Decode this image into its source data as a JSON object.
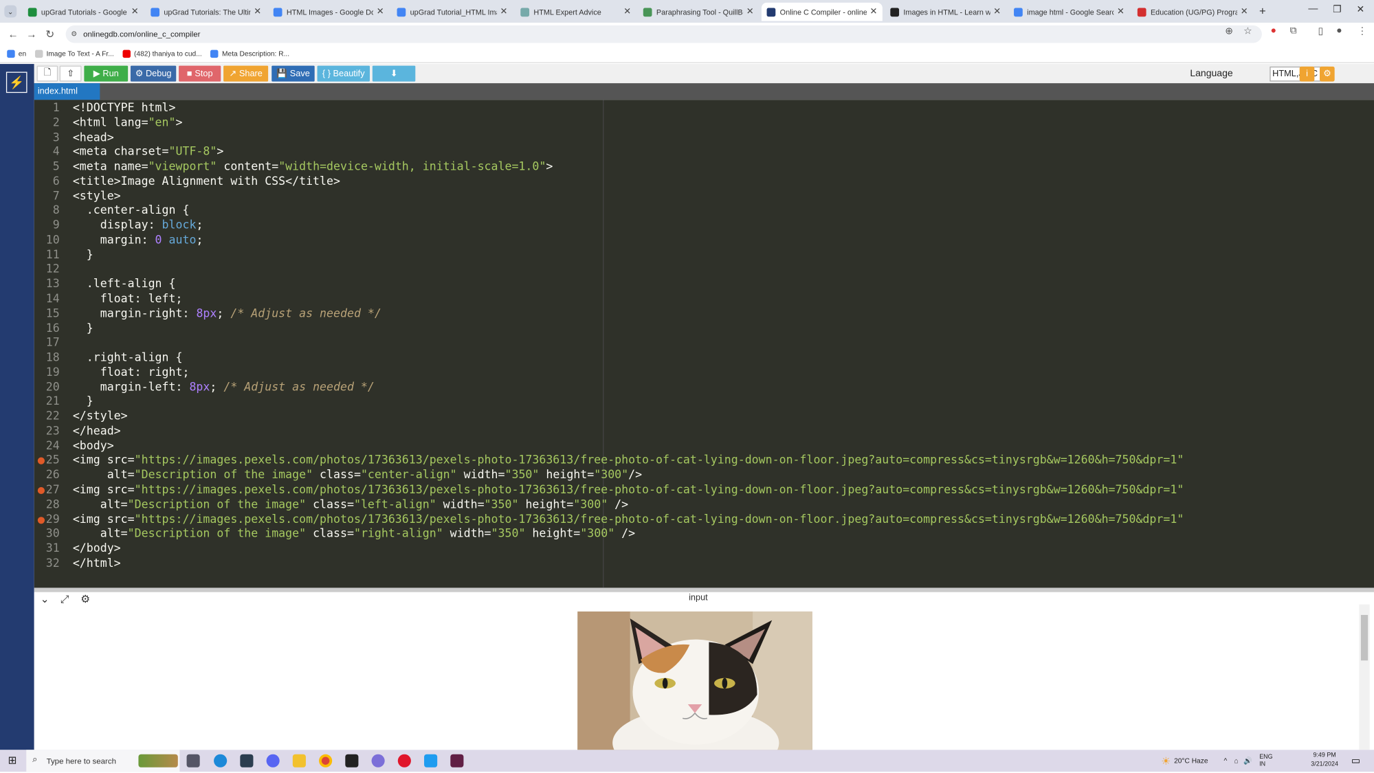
{
  "browser": {
    "tabs": [
      {
        "title": "upGrad Tutorials - Google Sh",
        "color": "#1e8e3e"
      },
      {
        "title": "upGrad Tutorials: The Ultimat",
        "color": "#4285f4"
      },
      {
        "title": "HTML Images - Google Docs",
        "color": "#4285f4"
      },
      {
        "title": "upGrad Tutorial_HTML Image",
        "color": "#4285f4"
      },
      {
        "title": "HTML Expert Advice",
        "color": "#7aa"
      },
      {
        "title": "Paraphrasing Tool - QuillBot A",
        "color": "#499557"
      },
      {
        "title": "Online C Compiler - online ed",
        "color": "#233b70"
      },
      {
        "title": "Images in HTML - Learn web",
        "color": "#222"
      },
      {
        "title": "image html - Google Search",
        "color": "#4285f4"
      },
      {
        "title": "Education (UG/PG) Programs",
        "color": "#d32f2f"
      }
    ],
    "url": "onlinegdb.com/online_c_compiler",
    "bookmarks": [
      {
        "label": "en",
        "color": "#4285f4"
      },
      {
        "label": "Image To Text - A Fr...",
        "color": "#ccc"
      },
      {
        "label": "(482) thaniya to cud...",
        "color": "#e00"
      },
      {
        "label": "Meta Description: R...",
        "color": "#4285f4"
      }
    ]
  },
  "toolbar": {
    "run": "Run",
    "debug": "Debug",
    "stop": "Stop",
    "share": "Share",
    "save": "Save",
    "beautify": "{ } Beautify",
    "language_label": "Language",
    "language_value": "HTML,JS,C"
  },
  "file_tab": "index.html",
  "code_lines": [
    [
      [
        "c-tag",
        "<!DOCTYPE html>"
      ]
    ],
    [
      [
        "c-tag",
        "<html lang="
      ],
      [
        "c-str",
        "\"en\""
      ],
      [
        "c-tag",
        ">"
      ]
    ],
    [
      [
        "c-tag",
        "<head>"
      ]
    ],
    [
      [
        "c-tag",
        "<meta charset="
      ],
      [
        "c-str",
        "\"UTF-8\""
      ],
      [
        "c-tag",
        ">"
      ]
    ],
    [
      [
        "c-tag",
        "<meta name="
      ],
      [
        "c-str",
        "\"viewport\""
      ],
      [
        "c-tag",
        " content="
      ],
      [
        "c-str",
        "\"width=device-width, initial-scale=1.0\""
      ],
      [
        "c-tag",
        ">"
      ]
    ],
    [
      [
        "c-tag",
        "<title>Image Alignment with CSS</title>"
      ]
    ],
    [
      [
        "c-tag",
        "<style>"
      ]
    ],
    [
      [
        "c-tag",
        "  .center-align {"
      ]
    ],
    [
      [
        "c-tag",
        "    display: "
      ],
      [
        "c-kw",
        "block"
      ],
      [
        "c-tag",
        ";"
      ]
    ],
    [
      [
        "c-tag",
        "    margin: "
      ],
      [
        "c-num",
        "0"
      ],
      [
        "c-tag",
        " "
      ],
      [
        "c-kw",
        "auto"
      ],
      [
        "c-tag",
        ";"
      ]
    ],
    [
      [
        "c-tag",
        "  }"
      ]
    ],
    [
      [
        "c-tag",
        ""
      ]
    ],
    [
      [
        "c-tag",
        "  .left-align {"
      ]
    ],
    [
      [
        "c-tag",
        "    float: left;"
      ]
    ],
    [
      [
        "c-tag",
        "    margin-right: "
      ],
      [
        "c-num",
        "8px"
      ],
      [
        "c-tag",
        "; "
      ],
      [
        "c-cm",
        "/* Adjust as needed */"
      ]
    ],
    [
      [
        "c-tag",
        "  }"
      ]
    ],
    [
      [
        "c-tag",
        ""
      ]
    ],
    [
      [
        "c-tag",
        "  .right-align {"
      ]
    ],
    [
      [
        "c-tag",
        "    float: right;"
      ]
    ],
    [
      [
        "c-tag",
        "    margin-left: "
      ],
      [
        "c-num",
        "8px"
      ],
      [
        "c-tag",
        "; "
      ],
      [
        "c-cm",
        "/* Adjust as needed */"
      ]
    ],
    [
      [
        "c-tag",
        "  }"
      ]
    ],
    [
      [
        "c-tag",
        "</style>"
      ]
    ],
    [
      [
        "c-tag",
        "</head>"
      ]
    ],
    [
      [
        "c-tag",
        "<body>"
      ]
    ],
    [
      [
        "c-tag",
        "<img src="
      ],
      [
        "c-str",
        "\"https://images.pexels.com/photos/17363613/pexels-photo-17363613/free-photo-of-cat-lying-down-on-floor.jpeg?auto=compress&cs=tinysrgb&w=1260&h=750&dpr=1\""
      ]
    ],
    [
      [
        "c-tag",
        "     alt="
      ],
      [
        "c-str",
        "\"Description of the image\""
      ],
      [
        "c-tag",
        " class="
      ],
      [
        "c-str",
        "\"center-align\""
      ],
      [
        "c-tag",
        " width="
      ],
      [
        "c-str",
        "\"350\""
      ],
      [
        "c-tag",
        " height="
      ],
      [
        "c-str",
        "\"300\""
      ],
      [
        "c-tag",
        "/>"
      ]
    ],
    [
      [
        "c-tag",
        "<img src="
      ],
      [
        "c-str",
        "\"https://images.pexels.com/photos/17363613/pexels-photo-17363613/free-photo-of-cat-lying-down-on-floor.jpeg?auto=compress&cs=tinysrgb&w=1260&h=750&dpr=1\""
      ]
    ],
    [
      [
        "c-tag",
        "    alt="
      ],
      [
        "c-str",
        "\"Description of the image\""
      ],
      [
        "c-tag",
        " class="
      ],
      [
        "c-str",
        "\"left-align\""
      ],
      [
        "c-tag",
        " width="
      ],
      [
        "c-str",
        "\"350\""
      ],
      [
        "c-tag",
        " height="
      ],
      [
        "c-str",
        "\"300\""
      ],
      [
        "c-tag",
        " />"
      ]
    ],
    [
      [
        "c-tag",
        "<img src="
      ],
      [
        "c-str",
        "\"https://images.pexels.com/photos/17363613/pexels-photo-17363613/free-photo-of-cat-lying-down-on-floor.jpeg?auto=compress&cs=tinysrgb&w=1260&h=750&dpr=1\""
      ]
    ],
    [
      [
        "c-tag",
        "    alt="
      ],
      [
        "c-str",
        "\"Description of the image\""
      ],
      [
        "c-tag",
        " class="
      ],
      [
        "c-str",
        "\"right-align\""
      ],
      [
        "c-tag",
        " width="
      ],
      [
        "c-str",
        "\"350\""
      ],
      [
        "c-tag",
        " height="
      ],
      [
        "c-str",
        "\"300\""
      ],
      [
        "c-tag",
        " />"
      ]
    ],
    [
      [
        "c-tag",
        "</body>"
      ]
    ],
    [
      [
        "c-tag",
        "</html>"
      ]
    ]
  ],
  "breakpoint_lines": [
    25,
    27,
    29
  ],
  "output_title": "input",
  "taskbar": {
    "search_placeholder": "Type here to search",
    "weather": "20°C  Haze",
    "lang": "ENG\nIN",
    "time": "9:49 PM",
    "date": "3/21/2024"
  }
}
